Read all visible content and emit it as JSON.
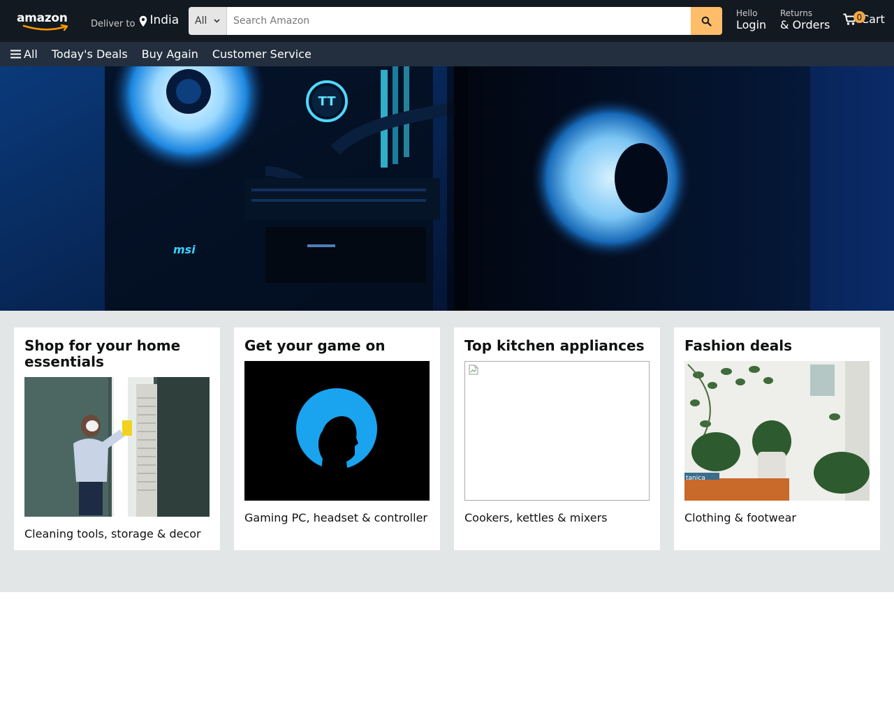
{
  "header": {
    "logo_text": "amazon",
    "deliver_small": "Deliver to",
    "deliver_location": "India",
    "search": {
      "category": "All",
      "placeholder": "Search Amazon",
      "value": ""
    },
    "account": {
      "line1": "Hello",
      "line2": "Login"
    },
    "orders": {
      "line1": "Returns",
      "line2": "& Orders"
    },
    "cart": {
      "count": "0",
      "label": "Cart"
    }
  },
  "subnav": {
    "all_label": "All",
    "items": [
      "Today's Deals",
      "Buy Again",
      "Customer Service"
    ]
  },
  "hero": {
    "brand_text": "msi"
  },
  "cards": [
    {
      "title": "Shop for your home essentials",
      "caption": "Cleaning tools, storage & decor"
    },
    {
      "title": "Get your game on",
      "caption": "Gaming PC, headset & controller"
    },
    {
      "title": "Top kitchen appliances",
      "caption": "Cookers, kettles & mixers"
    },
    {
      "title": "Fashion deals",
      "caption": "Clothing & footwear"
    }
  ],
  "colors": {
    "topbar": "#131921",
    "subnav": "#232f3e",
    "search_button": "#febd69",
    "cart_badge": "#f3a847",
    "page_background": "#e3e6e6"
  },
  "icons": [
    "location-pin-icon",
    "chevron-down-icon",
    "search-icon",
    "cart-icon",
    "hamburger-icon",
    "broken-image-icon"
  ]
}
